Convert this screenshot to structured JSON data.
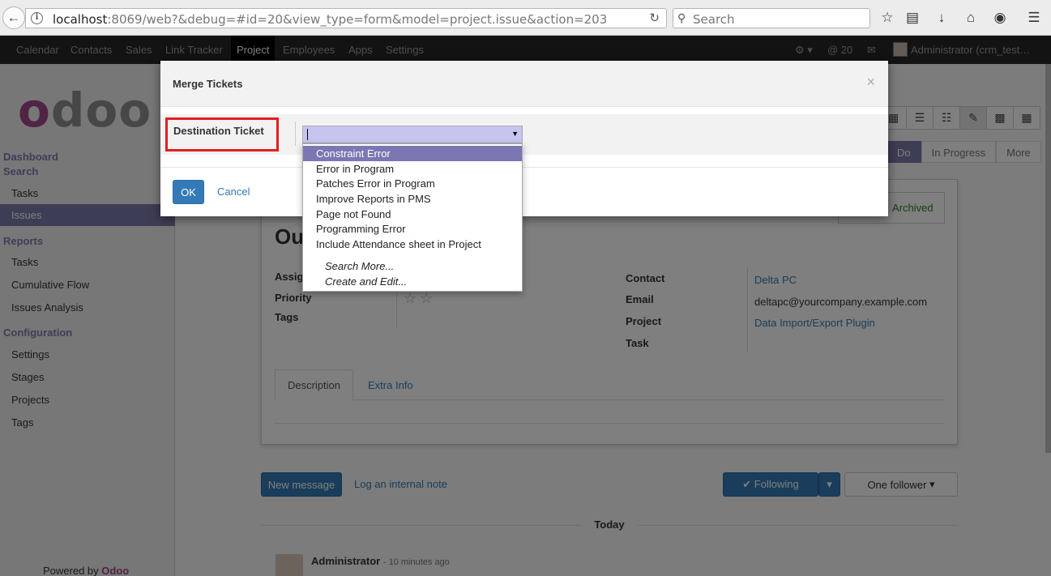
{
  "browser": {
    "url_host": "localhost",
    "url_rest": ":8069/web?&debug=#id=20&view_type=form&model=project.issue&action=203",
    "search_placeholder": "Search"
  },
  "topmenu": {
    "items": [
      "Calendar",
      "Contacts",
      "Sales",
      "Link Tracker",
      "Project",
      "Employees",
      "Apps",
      "Settings"
    ],
    "active": "Project",
    "messages_count": "@ 20",
    "user": "Administrator (crm_test…"
  },
  "sidebar": {
    "logo": "odoo",
    "dashboard": "Dashboard",
    "search": "Search",
    "search_items": [
      "Tasks",
      "Issues"
    ],
    "reports_head": "Reports",
    "reports_items": [
      "Tasks",
      "Cumulative Flow",
      "Issues Analysis"
    ],
    "config_head": "Configuration",
    "config_items": [
      "Settings",
      "Stages",
      "Projects",
      "Tags"
    ],
    "powered_prefix": "Powered by ",
    "powered_brand": "Odoo"
  },
  "form": {
    "stages": [
      "Do",
      "In Progress",
      "More"
    ],
    "archived_label": "Archived",
    "title_partial": "Ou",
    "left_fields": [
      "Assig",
      "Priority",
      "Tags"
    ],
    "right_fields": [
      "Contact",
      "Email",
      "Project",
      "Task"
    ],
    "contact": "Delta PC",
    "email": "deltapc@yourcompany.example.com",
    "project": "Data Import/Export Plugin",
    "tab_description": "Description",
    "tab_extra": "Extra Info"
  },
  "chatter": {
    "new_message": "New message",
    "log_note": "Log an internal note",
    "following": "✔ Following",
    "follower": "One follower",
    "today": "Today",
    "author": "Administrator",
    "time": "- 10 minutes ago"
  },
  "modal": {
    "title": "Merge Tickets",
    "close": "×",
    "field_label": "Destination Ticket",
    "ok": "OK",
    "cancel": "Cancel",
    "options": [
      "Constraint Error",
      "Error in Program",
      "Patches Error in Program",
      "Improve Reports in PMS",
      "Page not Found",
      "Programming Error",
      "Include Attendance sheet in Project"
    ],
    "search_more": "Search More...",
    "create_edit": "Create and Edit..."
  },
  "colors": {
    "accent": "#7c7bad",
    "brand": "#a24689",
    "primary_button": "#337ab7",
    "highlight_box": "#e0201e"
  }
}
